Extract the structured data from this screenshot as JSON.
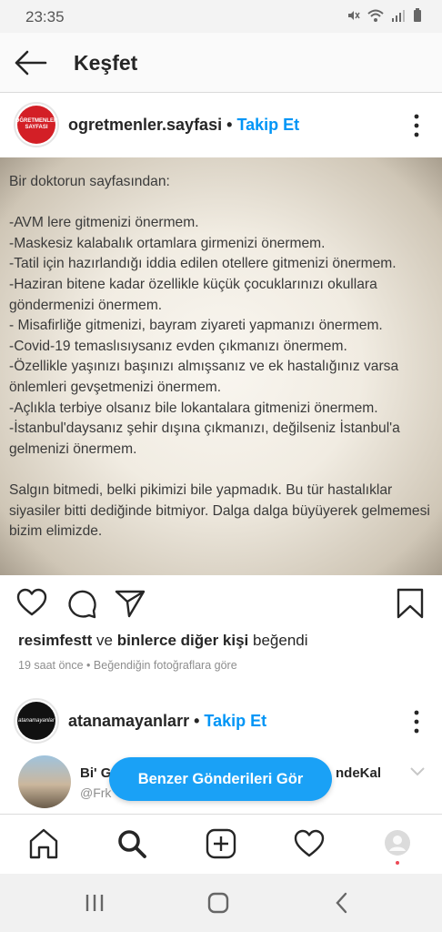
{
  "status_bar": {
    "time": "23:35"
  },
  "header": {
    "title": "Keşfet"
  },
  "post1": {
    "avatar_text": "ÖĞRETMENLER SAYFASI",
    "username": "ogretmenler.sayfasi",
    "separator": "•",
    "follow_label": "Takip Et",
    "image_text": "Bir doktorun sayfasından:\n\n-AVM lere gitmenizi önermem.\n-Maskesiz kalabalık ortamlara girmenizi önermem.\n-Tatil için hazırlandığı iddia edilen otellere gitmenizi önermem.\n-Haziran bitene kadar özellikle küçük çocuklarınızı okullara göndermenizi önermem.\n- Misafirliğe gitmenizi, bayram ziyareti yapmanızı önermem.\n-Covid-19 temaslısıysanız evden çıkmanızı önermem.\n-Özellikle yaşınızı başınızı almışsanız ve ek hastalığınız varsa önlemleri gevşetmenizi önermem.\n-Açlıkla terbiye olsanız bile lokantalara gitmenizi önermem.\n-İstanbul'daysanız şehir dışına çıkmanızı, değilseniz İstanbul'a gelmenizi önermem.\n\nSalgın bitmedi, belki pikimizi bile yapmadık. Bu tür hastalıklar siyasiler bitti dediğinde bitmiyor. Dalga dalga büyüyerek gelmemesi bizim elimizde.",
    "likes_user": "resimfestt",
    "likes_and": "ve",
    "likes_others": "binlerce diğer kişi",
    "likes_suffix": "beğendi",
    "meta": "19 saat önce • Beğendiğin fotoğraflara göre"
  },
  "post2": {
    "avatar_text": "atanamayanlar",
    "username": "atanamayanlarr",
    "separator": "•",
    "follow_label": "Takip Et",
    "preview_title_start": "Bi' G",
    "preview_title_end": "ndeKal",
    "preview_handle": "@Frk"
  },
  "similar_button": "Benzer Gönderileri Gör",
  "icons": {
    "status": [
      "mute-icon",
      "wifi-icon",
      "signal-icon",
      "battery-icon"
    ],
    "actions": [
      "heart-icon",
      "comment-icon",
      "share-icon",
      "bookmark-icon"
    ],
    "tabs": [
      "home-icon",
      "search-icon",
      "add-icon",
      "activity-icon",
      "profile-icon"
    ],
    "nav": [
      "recents-icon",
      "home-button-icon",
      "back-button-icon"
    ]
  },
  "colors": {
    "accent": "#0095f6",
    "button": "#1aa1f6",
    "notification_dot": "#ed4956"
  }
}
